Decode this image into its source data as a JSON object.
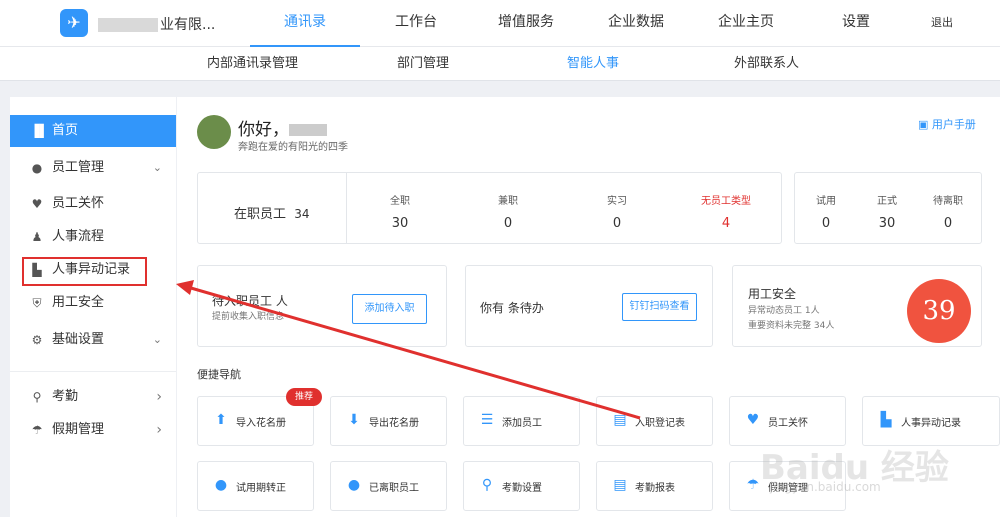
{
  "header": {
    "company_suffix": "业有限...",
    "nav": [
      "通讯录",
      "工作台",
      "增值服务",
      "企业数据",
      "企业主页",
      "设置",
      "退出"
    ],
    "active_nav": "通讯录"
  },
  "subnav": [
    "内部通讯录管理",
    "部门管理",
    "智能人事",
    "外部联系人"
  ],
  "sidebar": {
    "items": [
      {
        "label": "首页",
        "icon": "home-icon"
      },
      {
        "label": "员工管理",
        "icon": "users-icon"
      },
      {
        "label": "员工关怀",
        "icon": "heart-icon"
      },
      {
        "label": "人事流程",
        "icon": "person-icon"
      },
      {
        "label": "人事异动记录",
        "icon": "record-icon"
      },
      {
        "label": "用工安全",
        "icon": "shield-icon"
      },
      {
        "label": "基础设置",
        "icon": "gear-icon"
      },
      {
        "label": "考勤",
        "icon": "location-icon"
      },
      {
        "label": "假期管理",
        "icon": "palm-icon"
      }
    ]
  },
  "greeting": {
    "hello": "你好，",
    "motto": "奔跑在爱的有阳光的四季",
    "manual": "用户手册"
  },
  "employees": {
    "title": "在职员工",
    "count": "34",
    "types": [
      {
        "label": "全职",
        "value": "30"
      },
      {
        "label": "兼职",
        "value": "0"
      },
      {
        "label": "实习",
        "value": "0"
      },
      {
        "label": "无员工类型",
        "value": "4"
      }
    ],
    "status": [
      {
        "label": "试用",
        "value": "0"
      },
      {
        "label": "正式",
        "value": "30"
      },
      {
        "label": "待离职",
        "value": "0"
      }
    ]
  },
  "pending_onboard": {
    "title": "待入职员工 人",
    "sub": "提前收集入职信息",
    "button": "添加待入职"
  },
  "todo": {
    "title": "你有 条待办",
    "button": "钉钉扫码查看"
  },
  "safety": {
    "title": "用工安全",
    "line1": "异常动态员工 1人",
    "line2": "重要资料未完整 34人",
    "score": "39"
  },
  "quick_nav": {
    "title": "便捷导航",
    "badge": "推荐",
    "row1": [
      "导入花名册",
      "导出花名册",
      "添加员工",
      "入职登记表",
      "员工关怀",
      "人事异动记录"
    ],
    "row2": [
      "试用期转正",
      "已离职员工",
      "考勤设置",
      "考勤报表",
      "假期管理"
    ]
  },
  "watermark": {
    "brand": "Baidu 经验",
    "url": "jingyan.baidu.com"
  },
  "colors": {
    "accent": "#3296fa",
    "alert": "#e0302e"
  }
}
